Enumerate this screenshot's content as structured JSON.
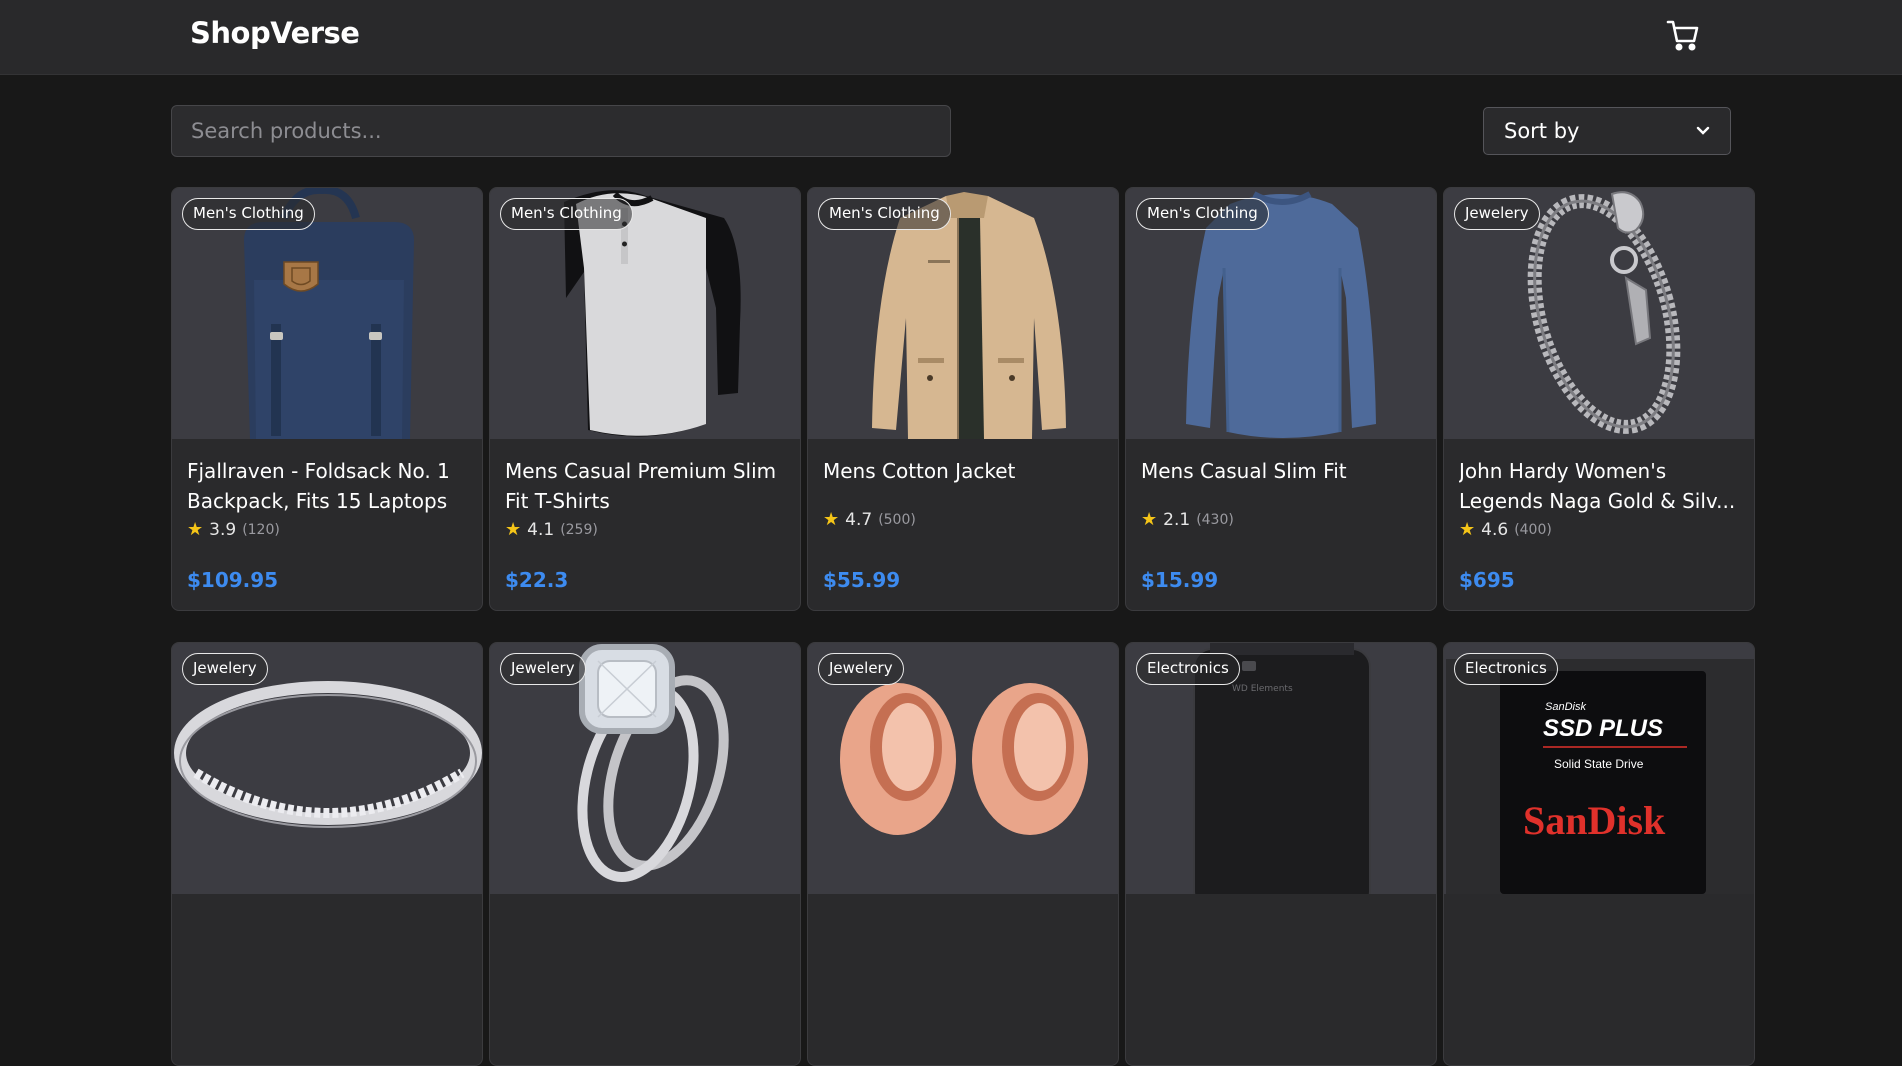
{
  "header": {
    "brand": "ShopVerse",
    "cart_icon": "shopping-cart-icon"
  },
  "search": {
    "placeholder": "Search products..."
  },
  "sort": {
    "label": "Sort by",
    "icon": "chevron-down-icon"
  },
  "colors": {
    "background": "#181818",
    "header": "#29292b",
    "card": "#2a2a2c",
    "price": "#3d8bf0",
    "star": "#f5c518"
  },
  "products": [
    {
      "category": "Men's Clothing",
      "title": "Fjallraven - Foldsack No. 1 Backpack, Fits 15 Laptops",
      "rating": "3.9",
      "count": "(120)",
      "price": "$109.95",
      "image": "backpack"
    },
    {
      "category": "Men's Clothing",
      "title": "Mens Casual Premium Slim Fit T-Shirts",
      "rating": "4.1",
      "count": "(259)",
      "price": "$22.3",
      "image": "raglan-shirt"
    },
    {
      "category": "Men's Clothing",
      "title": "Mens Cotton Jacket",
      "rating": "4.7",
      "count": "(500)",
      "price": "$55.99",
      "image": "jacket"
    },
    {
      "category": "Men's Clothing",
      "title": "Mens Casual Slim Fit",
      "rating": "2.1",
      "count": "(430)",
      "price": "$15.99",
      "image": "long-sleeve-shirt"
    },
    {
      "category": "Jewelery",
      "title": "John Hardy Women's Legends Naga Gold & Silv...",
      "rating": "4.6",
      "count": "(400)",
      "price": "$695",
      "image": "bracelet"
    },
    {
      "category": "Jewelery",
      "image": "ring-band"
    },
    {
      "category": "Jewelery",
      "image": "diamond-ring"
    },
    {
      "category": "Jewelery",
      "image": "rose-gold-plugs"
    },
    {
      "category": "Electronics",
      "image": "hard-drive",
      "image_text": "WD Elements"
    },
    {
      "category": "Electronics",
      "image": "ssd",
      "image_text": {
        "brand_small": "SanDisk",
        "model": "SSD PLUS",
        "subtitle": "Solid State Drive",
        "brand_logo": "SanDisk"
      }
    }
  ]
}
